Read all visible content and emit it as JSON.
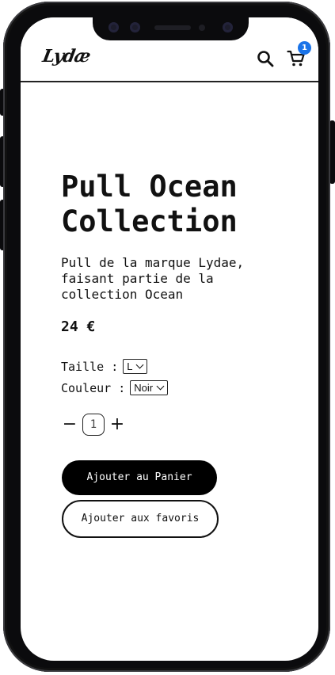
{
  "header": {
    "logo_text": "Lydæ",
    "search_icon": "search-icon",
    "cart_icon": "cart-icon",
    "cart_count": "1",
    "badge_color": "#1a73e8"
  },
  "product": {
    "title": "Pull Ocean Collection",
    "description": "Pull de la marque Lydae, faisant partie de la collection Ocean",
    "price": "24 €"
  },
  "options": {
    "size_label": "Taille :",
    "size_value": "L",
    "color_label": "Couleur :",
    "color_value": "Noir"
  },
  "quantity": {
    "minus": "−",
    "value": "1",
    "plus": "+"
  },
  "actions": {
    "add_to_cart": "Ajouter au Panier",
    "add_to_favorites": "Ajouter aux favoris"
  }
}
